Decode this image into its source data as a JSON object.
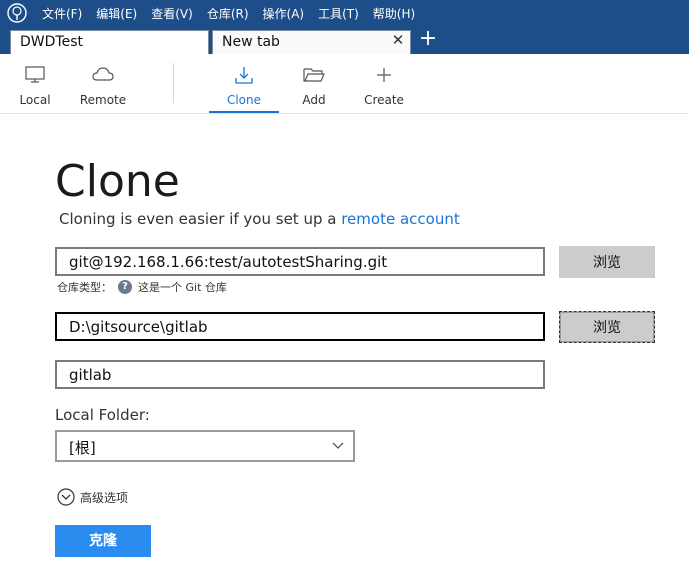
{
  "menu": {
    "items": [
      "文件(F)",
      "编辑(E)",
      "查看(V)",
      "仓库(R)",
      "操作(A)",
      "工具(T)",
      "帮助(H)"
    ]
  },
  "tabs": {
    "items": [
      {
        "label": "DWDTest"
      },
      {
        "label": "New tab"
      }
    ],
    "close_glyph": "✕",
    "new_tab_glyph": "+"
  },
  "toolbar": {
    "local": "Local",
    "remote": "Remote",
    "clone": "Clone",
    "add": "Add",
    "create": "Create"
  },
  "clone": {
    "title": "Clone",
    "subtitle_prefix": "Cloning is even easier if you set up a ",
    "subtitle_link": "remote account",
    "source_url": "git@192.168.1.66:test/autotestSharing.git",
    "browse_label": "浏览",
    "repo_type_label": "仓库类型：",
    "repo_type_help": "?",
    "repo_type_value": "这是一个 Git 仓库",
    "destination_path": "D:\\gitsource\\gitlab",
    "name": "gitlab",
    "local_folder_label": "Local Folder:",
    "local_folder_value": "[根]",
    "advanced_label": "高级选项",
    "clone_button": "克隆"
  },
  "colors": {
    "menubar_bg": "#1e4e8a",
    "accent": "#1a73d9",
    "primary_button": "#2b8cf0"
  }
}
